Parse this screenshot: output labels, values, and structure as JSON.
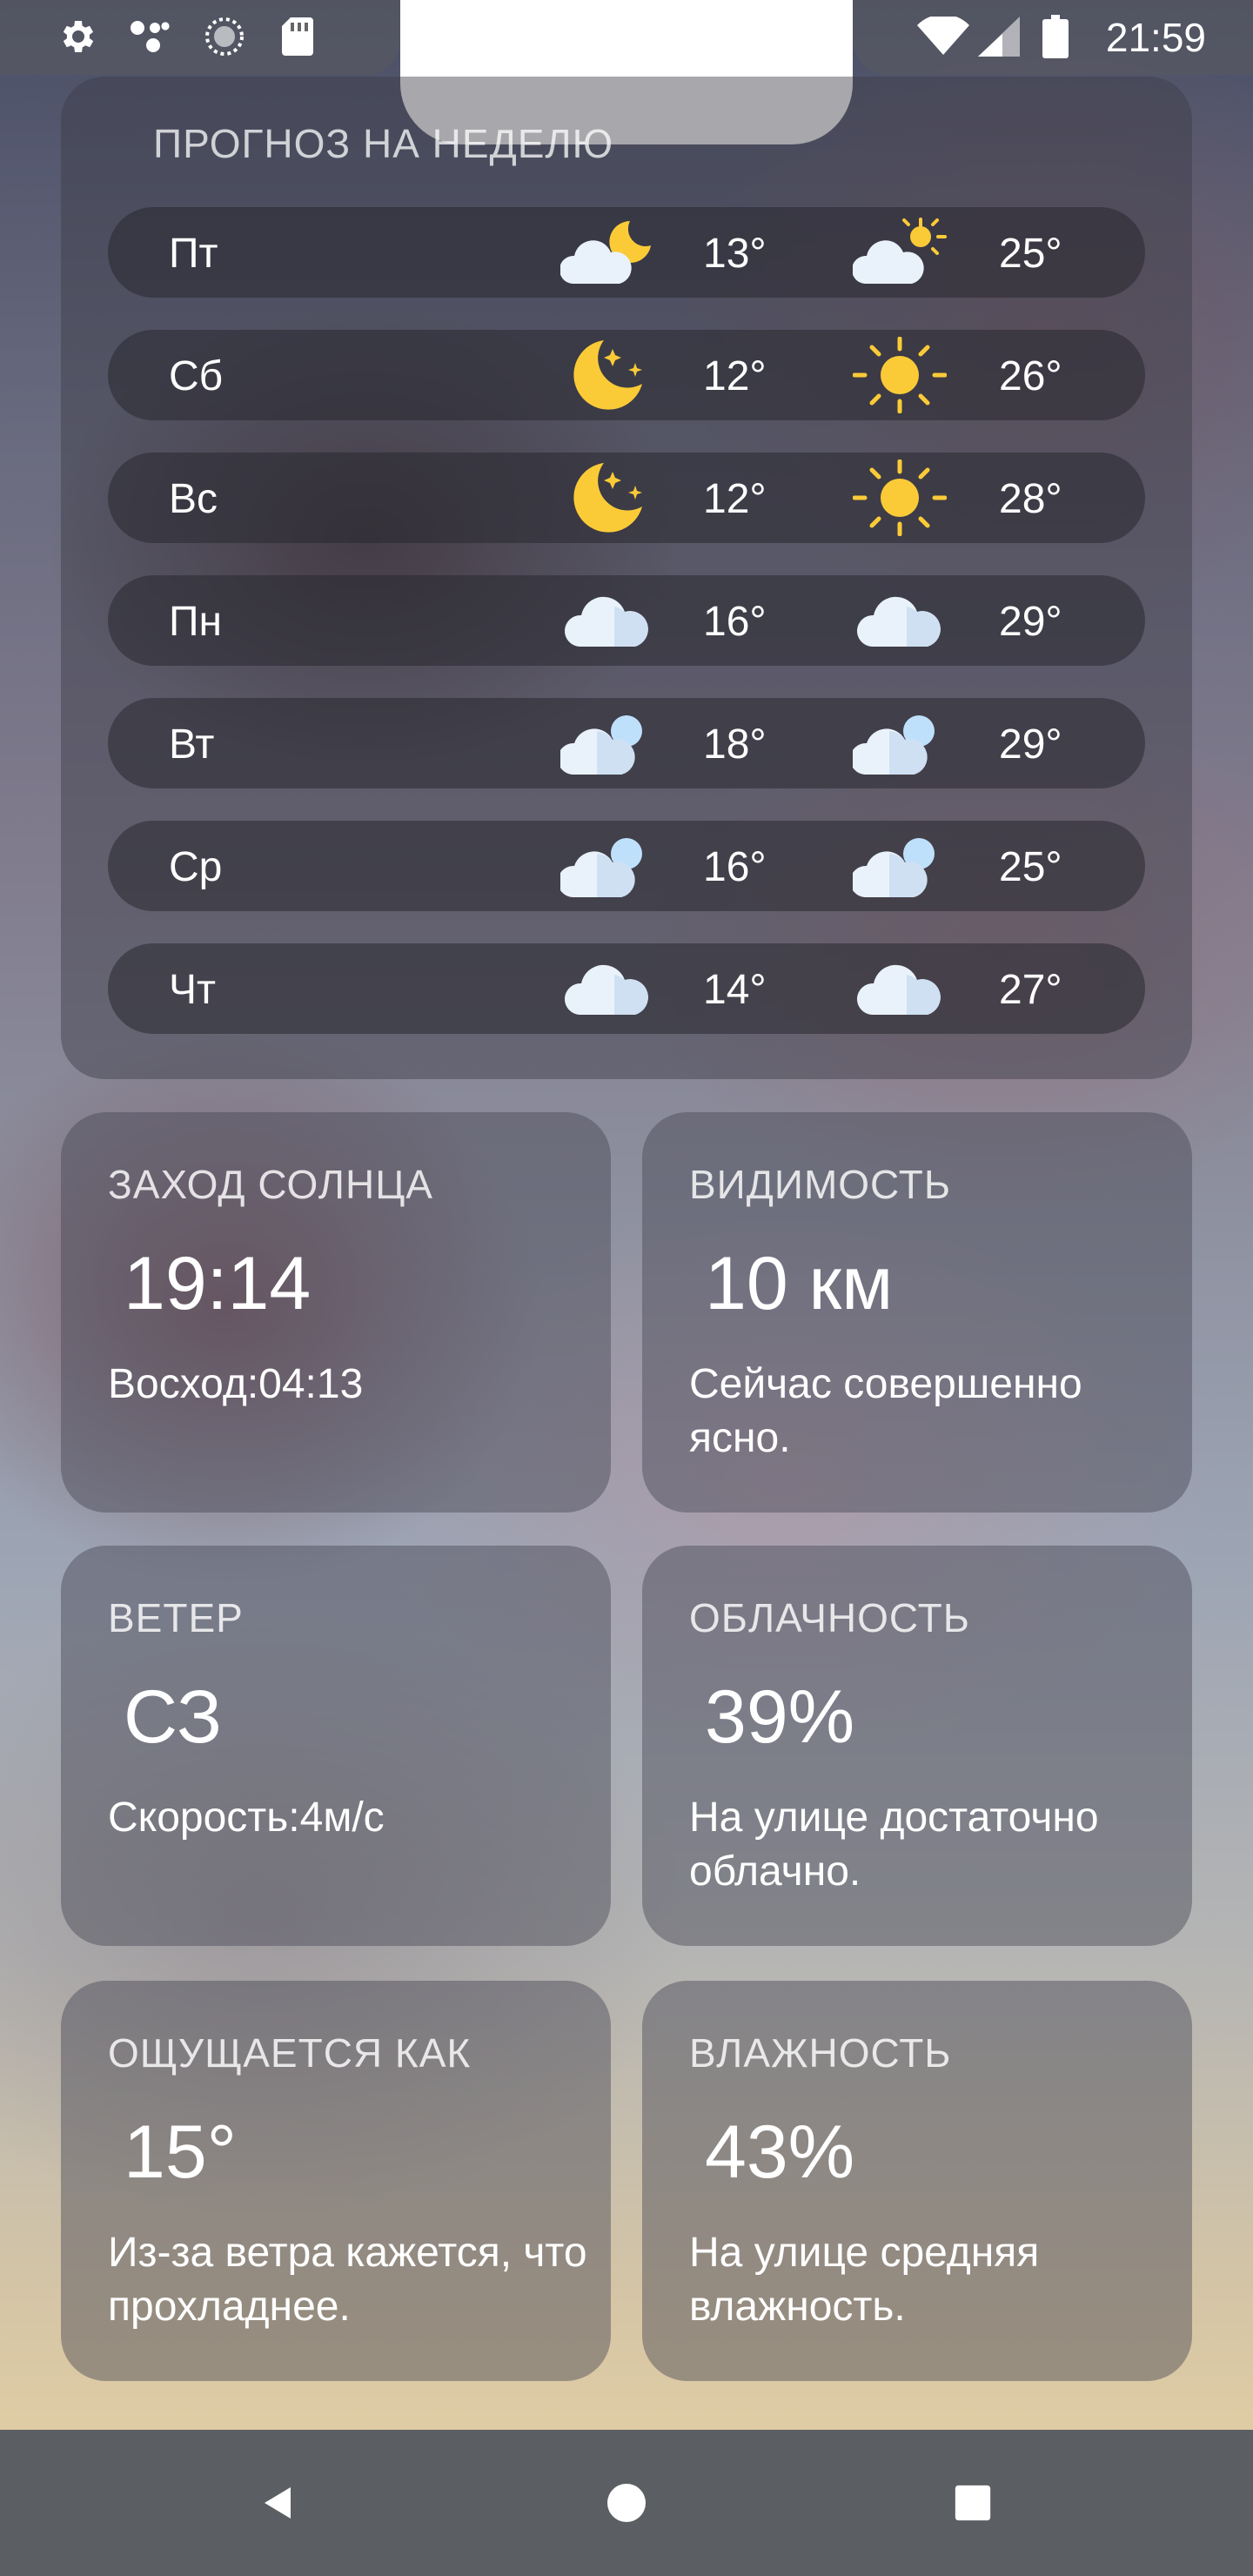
{
  "status_bar": {
    "time": "21:59",
    "icons_left": [
      "settings-icon",
      "assistant-icon",
      "sync-icon",
      "sd-card-icon"
    ],
    "icons_right": [
      "wifi-icon",
      "cellular-icon",
      "battery-icon"
    ]
  },
  "weekly": {
    "title": "ПРОГНОЗ НА НЕДЕЛЮ",
    "days": [
      {
        "day": "Пт",
        "night_icon": "cloud-moon-icon",
        "night_temp": "13°",
        "day_icon": "cloud-sun-icon",
        "day_temp": "25°"
      },
      {
        "day": "Сб",
        "night_icon": "moon-stars-icon",
        "night_temp": "12°",
        "day_icon": "sun-icon",
        "day_temp": "26°"
      },
      {
        "day": "Вс",
        "night_icon": "moon-stars-icon",
        "night_temp": "12°",
        "day_icon": "sun-icon",
        "day_temp": "28°"
      },
      {
        "day": "Пн",
        "night_icon": "cloud-icon",
        "night_temp": "16°",
        "day_icon": "cloud-icon",
        "day_temp": "29°"
      },
      {
        "day": "Вт",
        "night_icon": "clouds-icon",
        "night_temp": "18°",
        "day_icon": "clouds-icon",
        "day_temp": "29°"
      },
      {
        "day": "Ср",
        "night_icon": "clouds-icon",
        "night_temp": "16°",
        "day_icon": "clouds-icon",
        "day_temp": "25°"
      },
      {
        "day": "Чт",
        "night_icon": "cloud-icon",
        "night_temp": "14°",
        "day_icon": "cloud-icon",
        "day_temp": "27°"
      }
    ]
  },
  "cards": {
    "sunset": {
      "label": "ЗАХОД СОЛНЦА",
      "value": "19:14",
      "desc": "Восход:04:13"
    },
    "visibility": {
      "label": "ВИДИМОСТЬ",
      "value": "10 км",
      "desc": "Сейчас совершенно ясно."
    },
    "wind": {
      "label": "ВЕТЕР",
      "value": "СЗ",
      "desc": "Скорость:4м/с"
    },
    "clouds": {
      "label": "ОБЛАЧНОСТЬ",
      "value": "39%",
      "desc": "На улице достаточно облачно."
    },
    "feels_like": {
      "label": "ОЩУЩАЕТСЯ КАК",
      "value": "15°",
      "desc": "Из-за ветра кажется, что прохладнее."
    },
    "humidity": {
      "label": "ВЛАЖНОСТЬ",
      "value": "43%",
      "desc": "На улице средняя влажность."
    }
  },
  "nav": {
    "buttons": [
      "back-icon",
      "home-icon",
      "recents-icon"
    ]
  }
}
